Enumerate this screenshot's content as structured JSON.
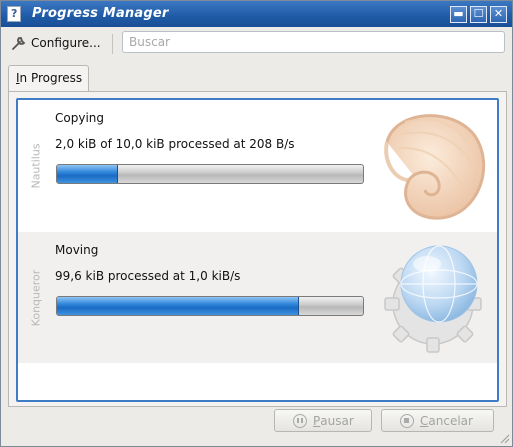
{
  "window": {
    "title": "Progress Manager",
    "app_icon": "document-icon",
    "controls": [
      "minimize",
      "maximize",
      "close"
    ]
  },
  "toolbar": {
    "configure_label": "Configure...",
    "configure_icon": "wrench-icon",
    "search_placeholder": "Buscar"
  },
  "tabs": [
    {
      "label": "In Progress",
      "mnemonic": "I",
      "rest": "n Progress",
      "selected": true
    }
  ],
  "jobs": [
    {
      "app": "Nautilus",
      "operation": "Copying",
      "detail": "2,0 kiB of 10,0 kiB processed at 208 B/s",
      "progress": 0.2,
      "icon": "nautilus-shell-icon"
    },
    {
      "app": "Konqueror",
      "operation": "Moving",
      "detail": "99,6 kiB processed at 1,0 kiB/s",
      "progress": 0.79,
      "icon": "konqueror-globe-gear-icon"
    }
  ],
  "buttons": {
    "pause": {
      "mnemonic": "P",
      "rest": "ausar",
      "icon": "pause-icon",
      "enabled": false
    },
    "cancel": {
      "mnemonic": "C",
      "rest": "ancelar",
      "icon": "stop-icon",
      "enabled": false
    }
  },
  "colors": {
    "titlebar": "#1f5aa6",
    "list_border": "#3f7cc6",
    "progress_fill": "#2f86da"
  }
}
